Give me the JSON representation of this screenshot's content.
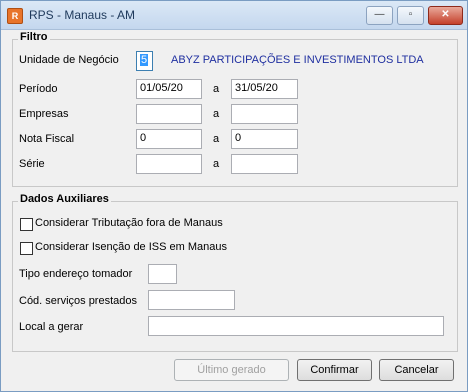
{
  "window": {
    "title": "RPS - Manaus - AM",
    "icon_glyph": "R"
  },
  "title_buttons": {
    "minimize": "—",
    "maximize": "▫",
    "close": "✕"
  },
  "filtro": {
    "title": "Filtro",
    "unidade_label": "Unidade de Negócio",
    "unidade_value": "5",
    "unidade_name": "ABYZ PARTICIPAÇÕES E INVESTIMENTOS LTDA",
    "periodo_label": "Período",
    "periodo_from": "01/05/20",
    "periodo_to": "31/05/20",
    "empresas_label": "Empresas",
    "empresas_from": "",
    "empresas_to": "",
    "nota_label": "Nota Fiscal",
    "nota_from": "0",
    "nota_to": "0",
    "serie_label": "Série",
    "serie_from": "",
    "serie_to": "",
    "range_sep": "a"
  },
  "aux": {
    "title": "Dados Auxiliares",
    "chk_tributacao_label": "Considerar Tributação fora de Manaus",
    "chk_tributacao_checked": false,
    "chk_isencao_label": "Considerar Isenção de ISS em Manaus",
    "chk_isencao_checked": false,
    "tipo_label": "Tipo endereço tomador",
    "tipo_value": "",
    "cod_label": "Cód. serviços prestados",
    "cod_value": "",
    "local_label": "Local a gerar",
    "local_value": ""
  },
  "buttons": {
    "ultimo": "Último gerado",
    "confirmar": "Confirmar",
    "cancelar": "Cancelar"
  }
}
